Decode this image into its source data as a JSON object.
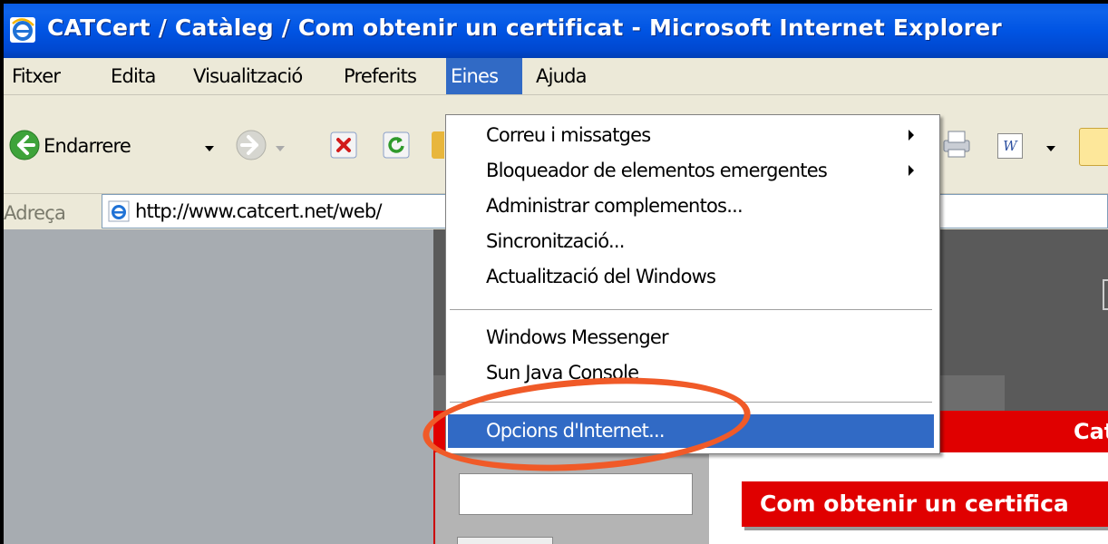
{
  "window": {
    "title": "CATCert / Catàleg / Com obtenir un certificat - Microsoft Internet Explorer"
  },
  "menubar": {
    "items": [
      {
        "label": "Fitxer"
      },
      {
        "label": "Edita"
      },
      {
        "label": "Visualització"
      },
      {
        "label": "Preferits"
      },
      {
        "label": "Eines",
        "active": true
      },
      {
        "label": "Ajuda"
      }
    ]
  },
  "toolbar": {
    "back_label": "Endarrere"
  },
  "address": {
    "label": "Adreça",
    "url": "http://www.catcert.net/web/"
  },
  "tools_menu": {
    "items": [
      {
        "label": "Correu i missatges",
        "submenu": true
      },
      {
        "label": "Bloqueador de elementos emergentes",
        "submenu": true
      },
      {
        "label": "Administrar complementos..."
      },
      {
        "label": "Sincronització..."
      },
      {
        "label": "Actualització del Windows"
      },
      {
        "label": "Windows Messenger"
      },
      {
        "label": "Sun Java Console"
      },
      {
        "label": "Opcions d'Internet...",
        "highlighted": true
      }
    ]
  },
  "page": {
    "red_bar_text": "Cat",
    "heading": "Com obtenir un certifica"
  },
  "colors": {
    "titlebar": "#0054e3",
    "menu_highlight": "#316ac5",
    "page_red": "#e00000",
    "annotation": "#f05a28"
  }
}
